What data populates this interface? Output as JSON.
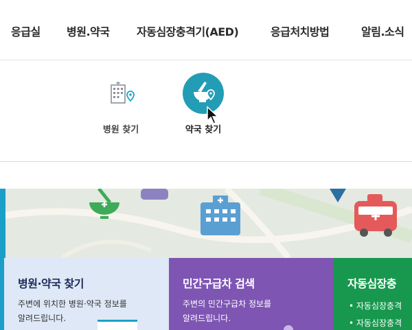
{
  "nav": {
    "items": [
      "응급실",
      "병원.약국",
      "자동심장충격기(AED)",
      "응급처치방법",
      "알림.소식"
    ]
  },
  "dropdown": {
    "items": [
      {
        "label": "병원 찾기",
        "icon": "hospital-building-icon"
      },
      {
        "label": "약국 찾기",
        "icon": "pharmacy-mortar-icon",
        "active": true
      }
    ]
  },
  "cards": [
    {
      "title": "병원·약국 찾기",
      "desc_line1": "주변에 위치한 병원·약국 정보를",
      "desc_line2": "알려드립니다."
    },
    {
      "title": "민간구급차 검색",
      "desc_line1": "주변의 민간구급차 정보를",
      "desc_line2": "알려드립니다."
    },
    {
      "title": "자동심장충",
      "items": [
        "• 자동심장충격",
        "• 자동심장충격"
      ]
    }
  ],
  "colors": {
    "accent_teal": "#239db6",
    "card_blue": "#dfe8f6",
    "card_purple": "#7e55b3",
    "card_green": "#17984e"
  }
}
